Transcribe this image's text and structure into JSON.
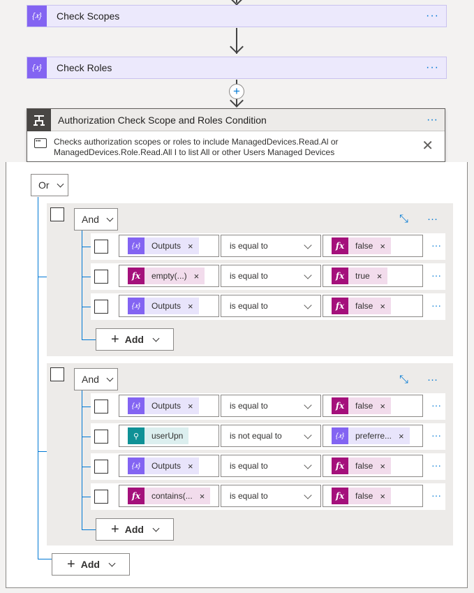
{
  "cards": [
    {
      "title": "Check Scopes",
      "icon": "variable-icon",
      "icon_glyph": "{𝑥}"
    },
    {
      "title": "Check Roles",
      "icon": "variable-icon",
      "icon_glyph": "{𝑥}"
    }
  ],
  "insert_step_glyph": "+",
  "condition": {
    "title": "Authorization Check Scope and Roles Condition",
    "description_line1": "Checks authorization scopes or roles to include ManagedDevices.Read.Al or",
    "description_line2": "ManagedDevices.Role.Read.All I to list All or other Users Managed Devices",
    "more": "···",
    "close": "✕"
  },
  "root_operator": "Or",
  "groups": [
    {
      "operator": "And",
      "rows": [
        {
          "left": {
            "type": "var",
            "label": "Outputs",
            "icon_glyph": "{𝑥}"
          },
          "op": "is equal to",
          "right": {
            "type": "fx",
            "label": "false",
            "icon_glyph": "fx"
          }
        },
        {
          "left": {
            "type": "fx",
            "label": "empty(...)",
            "icon_glyph": "fx"
          },
          "op": "is equal to",
          "right": {
            "type": "fx",
            "label": "true",
            "icon_glyph": "fx"
          }
        },
        {
          "left": {
            "type": "var",
            "label": "Outputs",
            "icon_glyph": "{𝑥}"
          },
          "op": "is equal to",
          "right": {
            "type": "fx",
            "label": "false",
            "icon_glyph": "fx"
          }
        }
      ],
      "add_label": "Add"
    },
    {
      "operator": "And",
      "rows": [
        {
          "left": {
            "type": "var",
            "label": "Outputs",
            "icon_glyph": "{𝑥}"
          },
          "op": "is equal to",
          "right": {
            "type": "fx",
            "label": "false",
            "icon_glyph": "fx"
          }
        },
        {
          "left": {
            "type": "usr",
            "label": "userUpn",
            "icon_glyph": "⚲"
          },
          "op": "is not equal to",
          "right": {
            "type": "var",
            "label": "preferre...",
            "icon_glyph": "{𝑥}"
          }
        },
        {
          "left": {
            "type": "var",
            "label": "Outputs",
            "icon_glyph": "{𝑥}"
          },
          "op": "is equal to",
          "right": {
            "type": "fx",
            "label": "false",
            "icon_glyph": "fx"
          }
        },
        {
          "left": {
            "type": "fx",
            "label": "contains(...",
            "icon_glyph": "fx"
          },
          "op": "is equal to",
          "right": {
            "type": "fx",
            "label": "false",
            "icon_glyph": "fx"
          }
        }
      ],
      "add_label": "Add"
    }
  ],
  "root_add_label": "Add",
  "remove_glyph": "×",
  "more_glyph": "···",
  "colors": {
    "accent": "#0078d4",
    "variable": "#8364f2",
    "expression": "#a4107b",
    "user": "#0f9196"
  }
}
